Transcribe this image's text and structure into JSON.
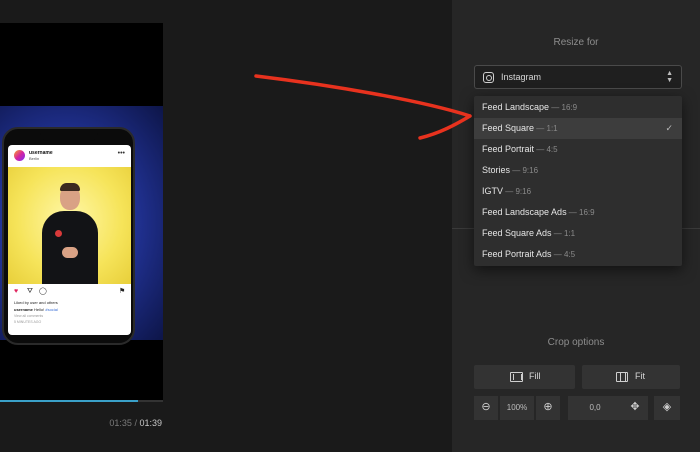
{
  "preview": {
    "post": {
      "username": "username",
      "location": "Berlin",
      "likes": "Liked by user and others",
      "caption_user": "username",
      "caption_text": " Hello! ",
      "caption_tag": "#social",
      "meta": "View all comments",
      "meta2": "5 MINUTES AGO"
    },
    "progress": 0.92,
    "time_current": "01:35",
    "time_separator": "/",
    "time_total": "01:39"
  },
  "panel": {
    "resize_title": "Resize for",
    "platform": "Instagram",
    "options": [
      {
        "name": "Feed Landscape",
        "ratio": "— 16:9",
        "selected": false
      },
      {
        "name": "Feed Square",
        "ratio": "— 1:1",
        "selected": true
      },
      {
        "name": "Feed Portrait",
        "ratio": "— 4:5",
        "selected": false
      },
      {
        "name": "Stories",
        "ratio": "— 9:16",
        "selected": false
      },
      {
        "name": "IGTV",
        "ratio": "— 9:16",
        "selected": false
      },
      {
        "name": "Feed Landscape Ads",
        "ratio": "— 16:9",
        "selected": false
      },
      {
        "name": "Feed Square Ads",
        "ratio": "— 1:1",
        "selected": false
      },
      {
        "name": "Feed Portrait Ads",
        "ratio": "— 4:5",
        "selected": false
      }
    ],
    "crop_title": "Crop options",
    "fill_label": "Fill",
    "fit_label": "Fit",
    "zoom": "100%",
    "position": "0,0"
  },
  "colors": {
    "annotation_arrow": "#e8321e",
    "progress": "#3aa0c8"
  }
}
